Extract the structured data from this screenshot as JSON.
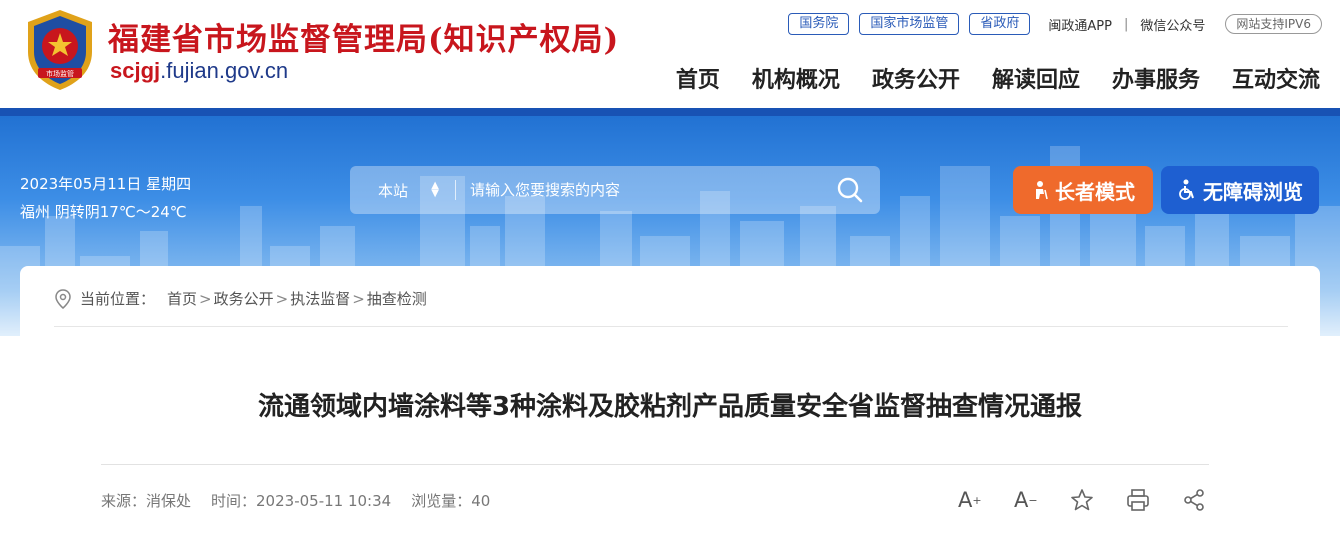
{
  "header": {
    "site_name": "福建省市场监督管理局(知识产权局)",
    "domain_highlight": "scjgj",
    "domain_rest": ".fujian.gov.cn",
    "emblem_text": "市场监管",
    "top_links": {
      "guowuyuan": "国务院",
      "samr": "国家市场监管",
      "provincial_gov": "省政府",
      "app": "闽政通APP",
      "separator": "|",
      "wechat": "微信公众号",
      "ipv6": "网站支持IPV6"
    },
    "nav": [
      "首页",
      "机构概况",
      "政务公开",
      "解读回应",
      "办事服务",
      "互动交流"
    ]
  },
  "banner": {
    "date": "2023年05月11日 星期四",
    "weather": "福州 阴转阴17℃～24℃",
    "search": {
      "scope": "本站",
      "placeholder": "请输入您要搜索的内容"
    },
    "elder_mode": "长者模式",
    "accessible": "无障碍浏览"
  },
  "breadcrumb": {
    "label": "当前位置：",
    "items": [
      "首页",
      "政务公开",
      "执法监督",
      "抽查检测"
    ],
    "separator": ">"
  },
  "article": {
    "title": "流通领域内墙涂料等3种涂料及胶粘剂产品质量安全省监督抽查情况通报",
    "source": "来源：消保处",
    "time": "时间：2023-05-11 10:34",
    "views": "浏览量：40"
  },
  "tools": {
    "font_larger": "A",
    "font_larger_sup": "+",
    "font_smaller": "A",
    "font_smaller_sup": "−"
  },
  "colors": {
    "brand_red": "#c8161d",
    "brand_blue": "#1f3a8a",
    "elder_orange": "#ef6a2c",
    "access_blue": "#1e5fd1"
  },
  "icons": [
    "location-icon",
    "search-icon",
    "elder-icon",
    "wheelchair-icon",
    "star-icon",
    "print-icon",
    "share-icon"
  ]
}
